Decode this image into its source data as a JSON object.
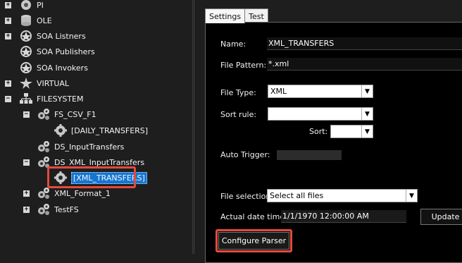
{
  "tree": {
    "items": [
      {
        "name": "tree-item-pi",
        "label": "PI",
        "icon": "pi-icon",
        "expander": "+"
      },
      {
        "name": "tree-item-ole",
        "label": "OLE",
        "icon": "database-icon",
        "expander": "+"
      },
      {
        "name": "tree-item-soa-listners",
        "label": "SOA Listners",
        "icon": "soa-icon",
        "expander": "+"
      },
      {
        "name": "tree-item-soa-publishers",
        "label": "SOA Publishers",
        "icon": "soa-icon",
        "expander": ""
      },
      {
        "name": "tree-item-soa-invokers",
        "label": "SOA Invokers",
        "icon": "soa-icon",
        "expander": ""
      },
      {
        "name": "tree-item-virtual",
        "label": "VIRTUAL",
        "icon": "virtual-icon",
        "expander": "+"
      },
      {
        "name": "tree-item-filesystem",
        "label": "FILESYSTEM",
        "icon": "hierarchy-icon",
        "expander": "−"
      },
      {
        "name": "tree-item-fs-csv-f1",
        "label": "FS_CSV_F1",
        "icon": "gears-icon",
        "expander": "−"
      },
      {
        "name": "tree-item-daily-transfers",
        "label": "[DAILY_TRANSFERS]",
        "icon": "gear-icon",
        "expander": ""
      },
      {
        "name": "tree-item-ds-inputtransfers",
        "label": "DS_InputTransfers",
        "icon": "gears-icon",
        "expander": ""
      },
      {
        "name": "tree-item-ds-xml-inputtransfers",
        "label": "DS_XML_InputTransfers",
        "icon": "gears-icon",
        "expander": "−"
      },
      {
        "name": "tree-item-xml-transfers",
        "label": "[XML_TRANSFERS]",
        "icon": "gear-icon",
        "expander": ""
      },
      {
        "name": "tree-item-xml-format-1",
        "label": "XML_Format_1",
        "icon": "gears-icon",
        "expander": "+"
      },
      {
        "name": "tree-item-testfs",
        "label": "TestFS",
        "icon": "gears-icon",
        "expander": "+"
      }
    ]
  },
  "tabs": {
    "settings": "Settings",
    "test": "Test"
  },
  "form": {
    "name_label": "Name:",
    "name_value": "XML_TRANSFERS",
    "file_pattern_label": "File Pattern:",
    "file_pattern_value": "*.xml",
    "file_type_label": "File Type:",
    "file_type_value": "XML",
    "sort_rule_label": "Sort rule:",
    "sort_rule_value": "",
    "sort_label": "Sort:",
    "sort_value": "",
    "auto_trigger_label": "Auto Trigger:",
    "file_selection_label": "File selection:",
    "file_selection_value": "Select all files",
    "actual_date_label": "Actual date  time:",
    "actual_date_value": "1/1/1970 12:00:00 AM",
    "update_button": "Update",
    "configure_parser_button": "Configure Parser"
  },
  "colors": {
    "highlight": "#e44a3d",
    "selection": "#1576d1"
  }
}
